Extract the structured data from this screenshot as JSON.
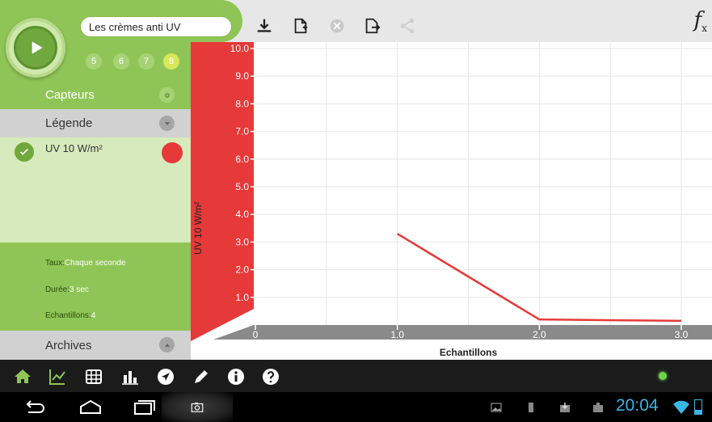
{
  "toolbar": {
    "title_value": "Les crèmes anti UV",
    "fx_label": "f",
    "fx_sub": "x",
    "icons": [
      "download-icon",
      "add-document-icon",
      "close-icon",
      "export-icon",
      "share-icon"
    ]
  },
  "channels": [
    "5",
    "6",
    "7",
    "8"
  ],
  "sidebar": {
    "capteurs_label": "Capteurs",
    "legende_label": "Légende",
    "archives_label": "Archives",
    "legend_item_label": "UV 10 W/m²",
    "legend_color": "#e63939",
    "taux_label": "Taux:",
    "taux_value": "Chaque seconde",
    "duree_label": "Durée:",
    "duree_value": "3 sec",
    "echantillons_label": "Echantillons:",
    "echantillons_value": "4"
  },
  "chart_data": {
    "type": "line",
    "xlabel": "Echantillons",
    "ylabel": "UV 10 W/m²",
    "xlim": [
      0,
      3
    ],
    "ylim": [
      0,
      10
    ],
    "x_ticks": [
      "0",
      "1.0",
      "2.0",
      "3.0"
    ],
    "y_ticks": [
      "1.0",
      "2.0",
      "3.0",
      "4.0",
      "5.0",
      "6.0",
      "7.0",
      "8.0",
      "9.0",
      "10.0"
    ],
    "grid": true,
    "series": [
      {
        "name": "UV 10 W/m²",
        "color": "#e63939",
        "x": [
          1,
          2,
          3
        ],
        "y": [
          3.3,
          0.2,
          0.15
        ]
      }
    ]
  },
  "app_toolbar": {
    "icons": [
      "home-icon",
      "chart-line-icon",
      "table-icon",
      "bar-chart-icon",
      "navigate-icon",
      "pen-icon",
      "info-icon",
      "help-icon"
    ]
  },
  "system_bar": {
    "time": "20:04",
    "battery_level": 0.3
  },
  "colors": {
    "accent_green": "#8fc556",
    "sidebar_light": "#c9e3a6",
    "axis_red": "#e63939",
    "clock_blue": "#39b6e6"
  }
}
